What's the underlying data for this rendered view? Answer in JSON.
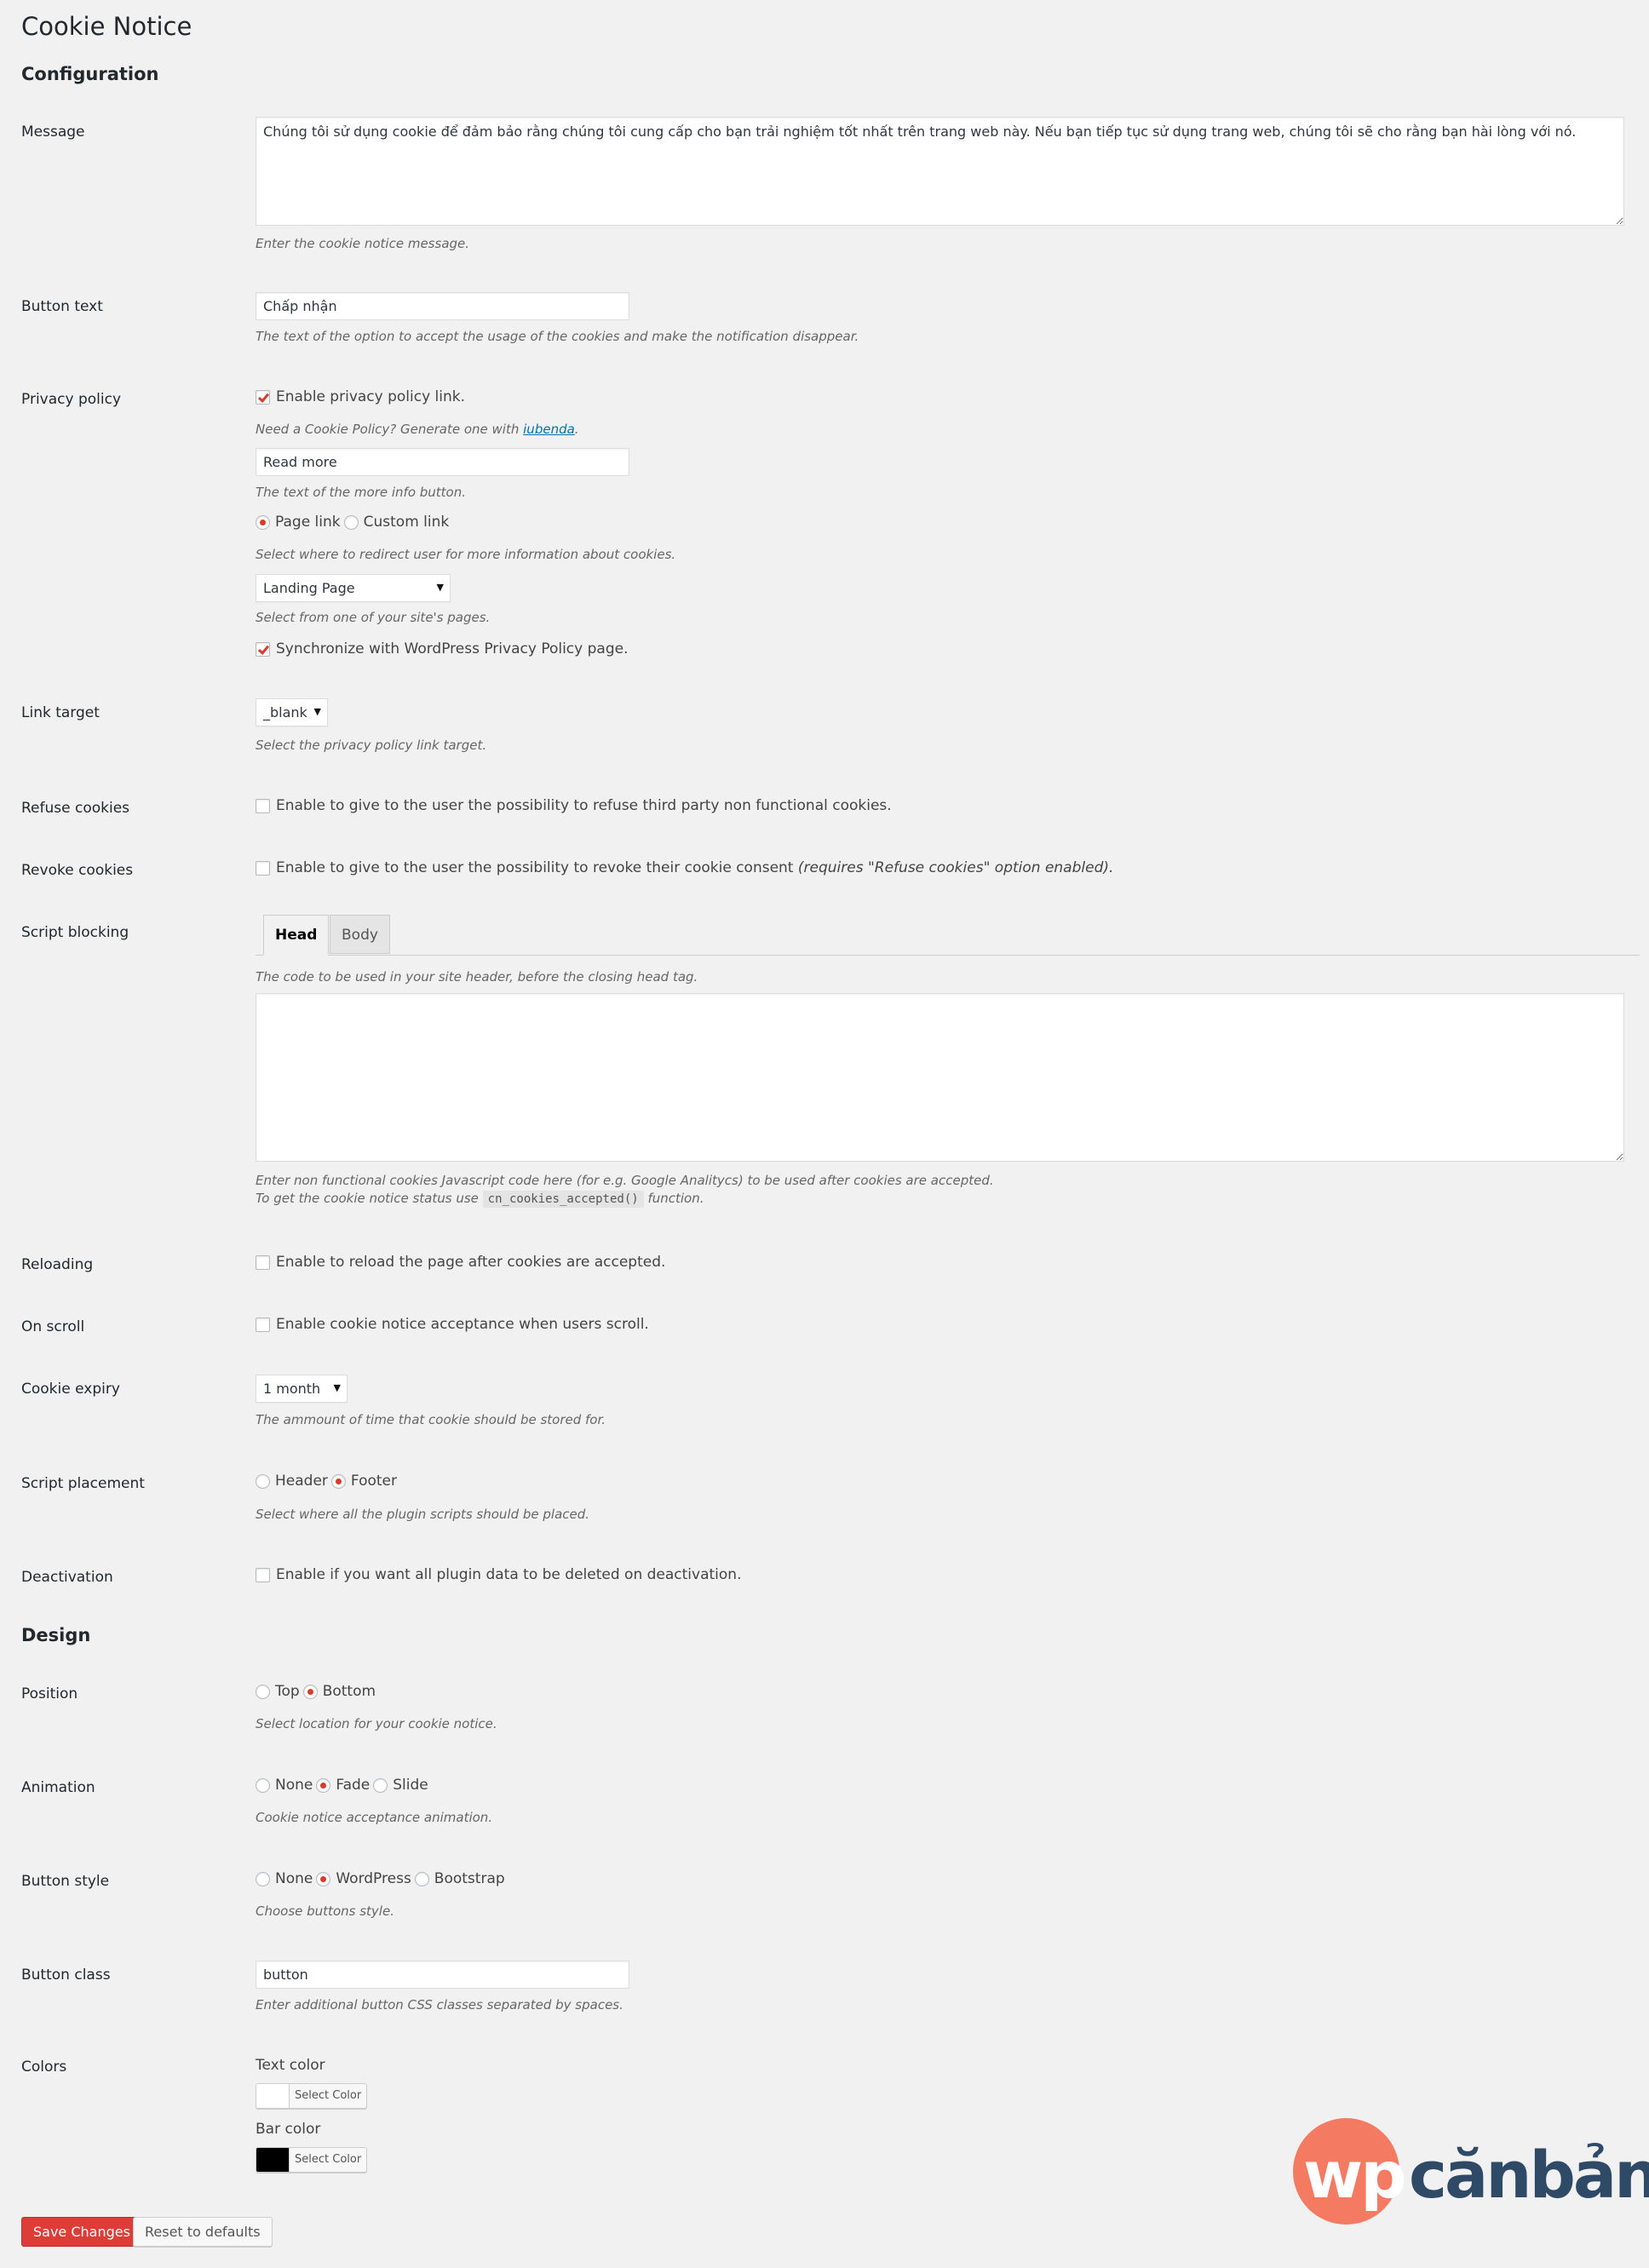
{
  "page": {
    "title": "Cookie Notice"
  },
  "sections": {
    "configuration": "Configuration",
    "design": "Design"
  },
  "message": {
    "label": "Message",
    "value": "Chúng tôi sử dụng cookie để đảm bảo rằng chúng tôi cung cấp cho bạn trải nghiệm tốt nhất trên trang web này. Nếu bạn tiếp tục sử dụng trang web, chúng tôi sẽ cho rằng bạn hài lòng với nó.",
    "desc": "Enter the cookie notice message."
  },
  "button_text": {
    "label": "Button text",
    "value": "Chấp nhận",
    "desc": "The text of the option to accept the usage of the cookies and make the notification disappear."
  },
  "privacy_policy": {
    "label": "Privacy policy",
    "enable_label": "Enable privacy policy link.",
    "enable_checked": true,
    "iubenda_prefix": "Need a Cookie Policy? Generate one with",
    "iubenda_link": "iubenda",
    "iubenda_suffix": ".",
    "more_value": "Read more",
    "more_desc": "The text of the more info button.",
    "link_options": [
      "Page link",
      "Custom link"
    ],
    "link_selected": "Page link",
    "link_desc": "Select where to redirect user for more information about cookies.",
    "page_selected": "Landing Page",
    "page_desc": "Select from one of your site's pages.",
    "sync_label": "Synchronize with WordPress Privacy Policy page.",
    "sync_checked": true
  },
  "link_target": {
    "label": "Link target",
    "value": "_blank",
    "desc": "Select the privacy policy link target."
  },
  "refuse_cookies": {
    "label": "Refuse cookies",
    "text": "Enable to give to the user the possibility to refuse third party non functional cookies.",
    "checked": false
  },
  "revoke_cookies": {
    "label": "Revoke cookies",
    "text": "Enable to give to the user the possibility to revoke their cookie consent",
    "text_italic": "(requires \"Refuse cookies\" option enabled).",
    "checked": false
  },
  "script_blocking": {
    "label": "Script blocking",
    "tabs": [
      "Head",
      "Body"
    ],
    "active_tab": "Head",
    "head_desc": "The code to be used in your site header, before the closing head tag.",
    "code_value": "",
    "note_line1": "Enter non functional cookies Javascript code here (for e.g. Google Analitycs) to be used after cookies are accepted.",
    "note_line2_prefix": "To get the cookie notice status use",
    "note_code": "cn_cookies_accepted()",
    "note_line2_suffix": "function."
  },
  "reloading": {
    "label": "Reloading",
    "text": "Enable to reload the page after cookies are accepted.",
    "checked": false
  },
  "on_scroll": {
    "label": "On scroll",
    "text": "Enable cookie notice acceptance when users scroll.",
    "checked": false
  },
  "cookie_expiry": {
    "label": "Cookie expiry",
    "value": "1 month",
    "desc": "The ammount of time that cookie should be stored for."
  },
  "script_placement": {
    "label": "Script placement",
    "options": [
      "Header",
      "Footer"
    ],
    "selected": "Footer",
    "desc": "Select where all the plugin scripts should be placed."
  },
  "deactivation": {
    "label": "Deactivation",
    "text": "Enable if you want all plugin data to be deleted on deactivation.",
    "checked": false
  },
  "position": {
    "label": "Position",
    "options": [
      "Top",
      "Bottom"
    ],
    "selected": "Bottom",
    "desc": "Select location for your cookie notice."
  },
  "animation": {
    "label": "Animation",
    "options": [
      "None",
      "Fade",
      "Slide"
    ],
    "selected": "Fade",
    "desc": "Cookie notice acceptance animation."
  },
  "button_style": {
    "label": "Button style",
    "options": [
      "None",
      "WordPress",
      "Bootstrap"
    ],
    "selected": "WordPress",
    "desc": "Choose buttons style."
  },
  "button_class": {
    "label": "Button class",
    "value": "button",
    "desc": "Enter additional button CSS classes separated by spaces."
  },
  "colors": {
    "label": "Colors",
    "text_color_label": "Text color",
    "text_color": "#ffffff",
    "bar_color_label": "Bar color",
    "bar_color": "#000000",
    "select_color": "Select Color"
  },
  "actions": {
    "save": "Save Changes",
    "reset": "Reset to defaults"
  },
  "brand": {
    "logo_wp": "wp",
    "logo_rest": "cănbản",
    "accent": "#f47a62",
    "dark": "#2e4a66",
    "primary_button": "#dd3d36",
    "check_color": "#d93b2b"
  }
}
